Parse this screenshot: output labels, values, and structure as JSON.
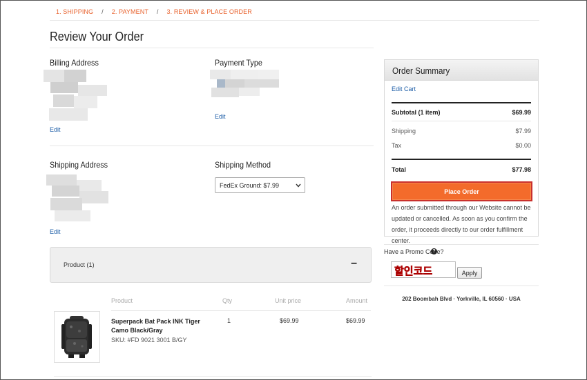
{
  "steps": [
    "1. SHIPPING",
    "2. PAYMENT",
    "3. REVIEW & PLACE ORDER"
  ],
  "step_separator": "/",
  "page_title": "Review Your Order",
  "billing": {
    "label": "Billing Address",
    "edit": "Edit"
  },
  "payment": {
    "label": "Payment Type",
    "edit": "Edit"
  },
  "shipping_address": {
    "label": "Shipping Address",
    "edit": "Edit"
  },
  "shipping_method": {
    "label": "Shipping Method",
    "selected": "FedEx Ground: $7.99"
  },
  "product_panel": {
    "label": "Product (1)",
    "toggle": "–"
  },
  "table": {
    "headers": [
      "Product",
      "Qty",
      "Unit price",
      "Amount"
    ],
    "rows": [
      {
        "name": "Superpack Bat Pack INK Tiger Camo Black/Gray",
        "sku": "SKU: #FD 9021 3001 B/GY",
        "qty": "1",
        "unit_price": "$69.99",
        "amount": "$69.99"
      }
    ]
  },
  "summary": {
    "title": "Order Summary",
    "edit_cart": "Edit Cart",
    "subtotal_label": "Subtotal (1 item)",
    "subtotal_value": "$69.99",
    "shipping_label": "Shipping",
    "shipping_value": "$7.99",
    "tax_label": "Tax",
    "tax_value": "$0.00",
    "total_label": "Total",
    "total_value": "$77.98",
    "place_order": "Place Order",
    "notice": "An order submitted through our Website cannot be updated or cancelled. As soon as you confirm the order, it proceeds directly to our order fulfillment center."
  },
  "promo": {
    "label": "Have a Promo Code?",
    "help": "?",
    "code_value": "할인코드",
    "apply": "Apply"
  },
  "store_address": "202 Boombah Blvd  ·  Yorkville, IL 60560 · USA",
  "colors": {
    "accent": "#e8612c",
    "button": "#f36b2b",
    "link": "#1f5fa8"
  }
}
